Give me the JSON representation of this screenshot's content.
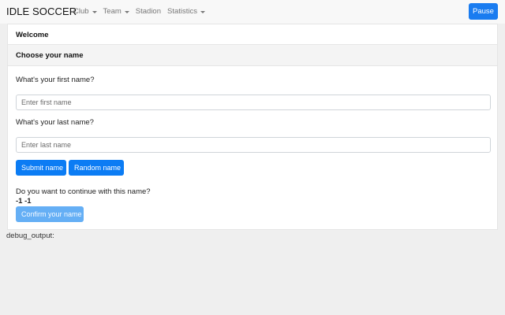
{
  "app": {
    "brand": "IDLE SOCCER"
  },
  "nav": {
    "items": [
      {
        "label": "Club",
        "dropdown": true
      },
      {
        "label": "Team",
        "dropdown": true
      },
      {
        "label": "Stadion",
        "dropdown": false
      },
      {
        "label": "Statistics",
        "dropdown": true
      }
    ],
    "pause_label": "Pause"
  },
  "welcome": {
    "title": "Welcome",
    "section_title": "Choose your name",
    "first_name": {
      "question": "What's your first name?",
      "placeholder": "Enter first name",
      "value": ""
    },
    "last_name": {
      "question": "What's your last name?",
      "placeholder": "Enter last name",
      "value": ""
    },
    "buttons": {
      "submit_label": "Submit name",
      "random_label": "Random name",
      "confirm_label": "Confirm your name"
    },
    "confirm_question": "Do you want to continue with this name?",
    "name_preview": "-1 -1"
  },
  "debug": {
    "label": "debug_output:"
  },
  "colors": {
    "primary": "#0b7cf4",
    "disabled": "#65aff5",
    "background": "#efefef",
    "navbar": "#f8f8f8"
  }
}
